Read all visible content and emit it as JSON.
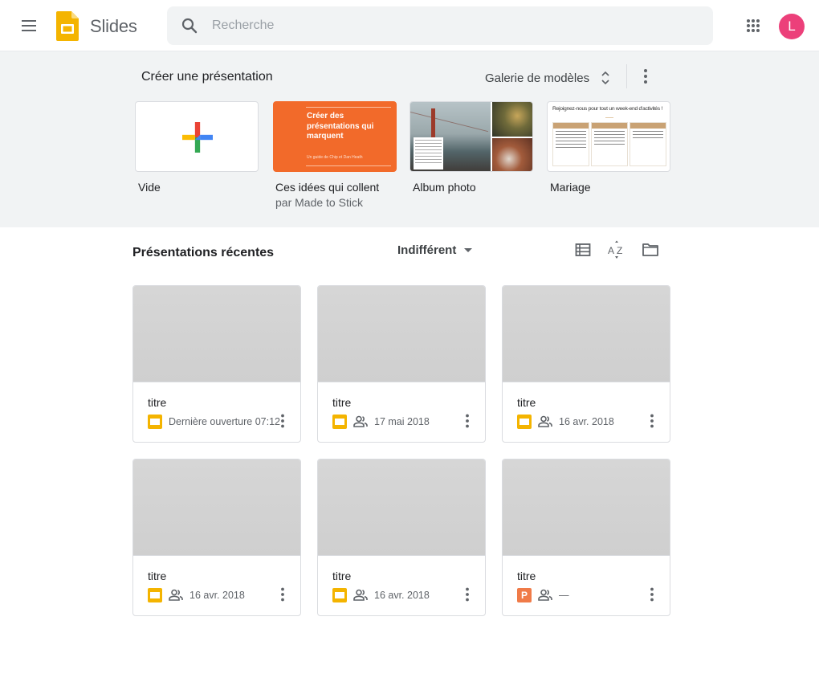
{
  "header": {
    "app_name": "Slides",
    "search_placeholder": "Recherche",
    "avatar_initial": "L",
    "avatar_color": "#ec407a"
  },
  "templates": {
    "title": "Créer une présentation",
    "gallery_label": "Galerie de modèles",
    "items": [
      {
        "label": "Vide",
        "sub": "",
        "icon": "plus-icon"
      },
      {
        "label": "Ces idées qui collent",
        "sub": "par Made to Stick",
        "thumb_title": "Créer des présentations qui marquent",
        "thumb_sub": "Un guide de Chip et Dan Heath",
        "color": "#f26a2a"
      },
      {
        "label": "Album photo",
        "sub": ""
      },
      {
        "label": "Mariage",
        "sub": "",
        "thumb_title": "Rejoignez-nous pour tout un week-end d'activités !"
      }
    ]
  },
  "recent": {
    "title": "Présentations récentes",
    "owner_filter": "Indifférent",
    "docs": [
      {
        "title": "titre",
        "type": "slides",
        "shared": false,
        "date": "Dernière ouverture 07:12"
      },
      {
        "title": "titre",
        "type": "slides",
        "shared": true,
        "date": "17 mai 2018"
      },
      {
        "title": "titre",
        "type": "slides",
        "shared": true,
        "date": "16 avr. 2018"
      },
      {
        "title": "titre",
        "type": "slides",
        "shared": true,
        "date": "16 avr. 2018"
      },
      {
        "title": "titre",
        "type": "slides",
        "shared": true,
        "date": "16 avr. 2018"
      },
      {
        "title": "titre",
        "type": "powerpoint",
        "shared": true,
        "date": "—",
        "type_letter": "P"
      }
    ]
  },
  "colors": {
    "slides_yellow": "#f4b400",
    "powerpoint_orange": "#f07b48",
    "template_bg": "#f1f3f4"
  }
}
